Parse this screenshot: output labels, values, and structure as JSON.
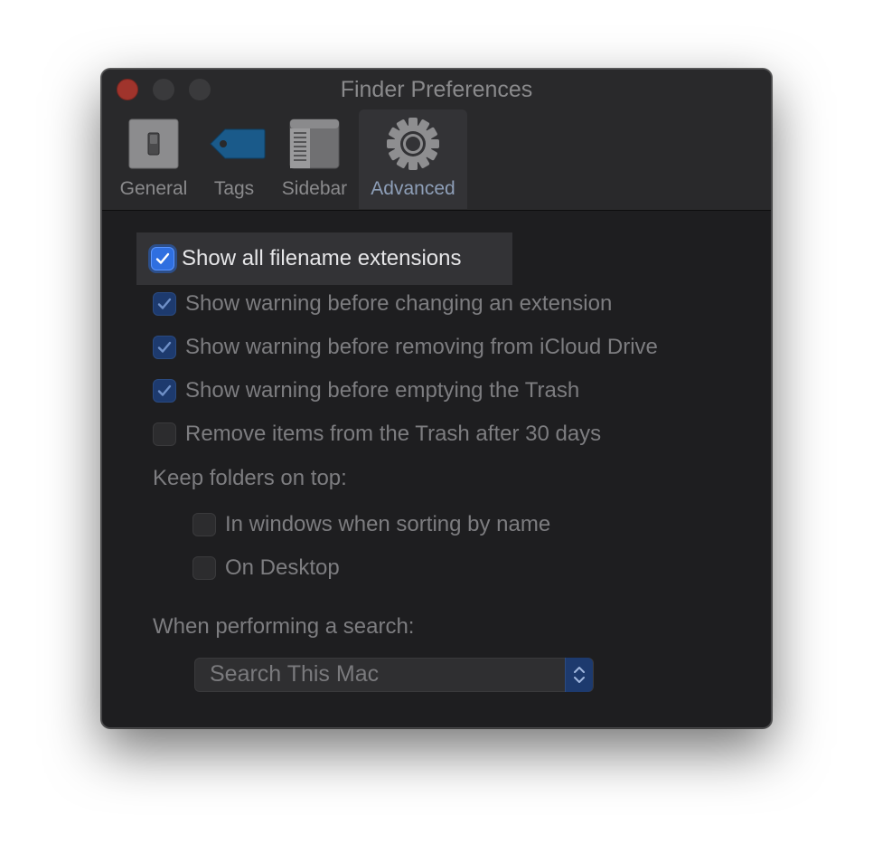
{
  "window": {
    "title": "Finder Preferences"
  },
  "tabs": [
    {
      "label": "General",
      "icon": "switch-icon",
      "active": false
    },
    {
      "label": "Tags",
      "icon": "tag-icon",
      "active": false
    },
    {
      "label": "Sidebar",
      "icon": "sidebar-icon",
      "active": false
    },
    {
      "label": "Advanced",
      "icon": "gear-icon",
      "active": true
    }
  ],
  "options": [
    {
      "label": "Show all filename extensions",
      "checked": true
    },
    {
      "label": "Show warning before changing an extension",
      "checked": true
    },
    {
      "label": "Show warning before removing from iCloud Drive",
      "checked": true
    },
    {
      "label": "Show warning before emptying the Trash",
      "checked": true
    },
    {
      "label": "Remove items from the Trash after 30 days",
      "checked": false
    }
  ],
  "keep_folders": {
    "heading": "Keep folders on top:",
    "options": [
      {
        "label": "In windows when sorting by name",
        "checked": false
      },
      {
        "label": "On Desktop",
        "checked": false
      }
    ]
  },
  "search": {
    "heading": "When performing a search:",
    "selected": "Search This Mac"
  },
  "colors": {
    "accent": "#2f6fe0",
    "window_bg": "#1e1e20",
    "close_button": "#a0342c"
  }
}
